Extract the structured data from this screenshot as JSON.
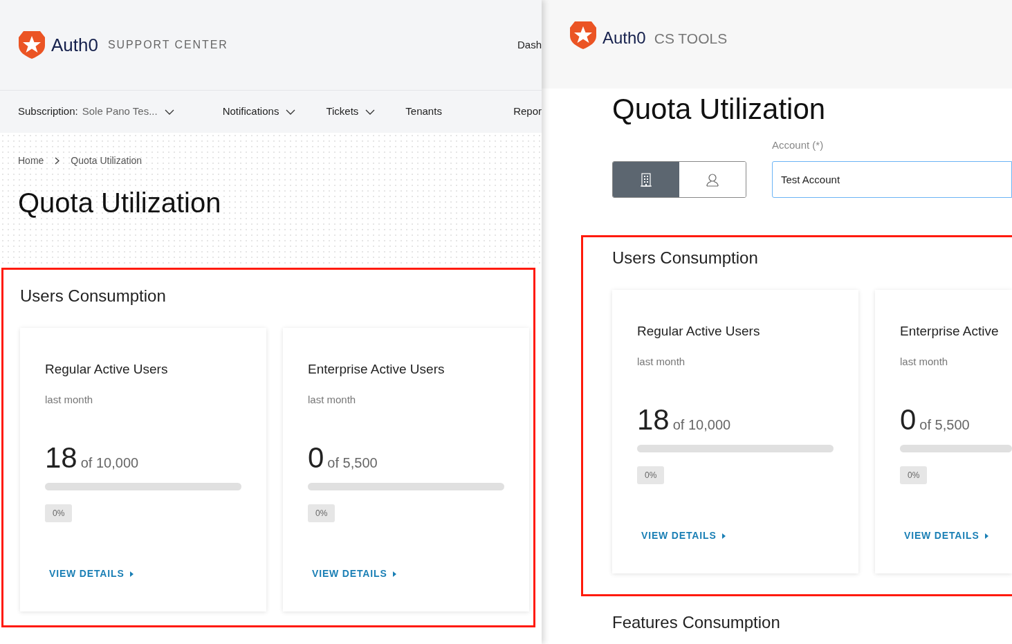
{
  "left": {
    "brand": "Auth0",
    "product": "SUPPORT CENTER",
    "top_link": "Dash",
    "nav": [
      {
        "label": "Subscription:",
        "value": "Sole Pano Tes...",
        "dropdown": true
      },
      {
        "label": "Notifications",
        "dropdown": true
      },
      {
        "label": "Tickets",
        "dropdown": true
      },
      {
        "label": "Tenants",
        "dropdown": false
      },
      {
        "label": "Repor",
        "dropdown": false
      }
    ],
    "breadcrumb": [
      "Home",
      "Quota Utilization"
    ],
    "title": "Quota Utilization",
    "section": {
      "title": "Users Consumption",
      "highlighted": true,
      "cards": [
        {
          "title": "Regular Active Users",
          "subtitle": "last month",
          "value": "18",
          "total": "of 10,000",
          "level": 0,
          "percent": "0%",
          "link": "VIEW DETAILS"
        },
        {
          "title": "Enterprise Active Users",
          "subtitle": "last month",
          "value": "0",
          "total": "of 5,500",
          "level": 0,
          "percent": "0%",
          "link": "VIEW DETAILS"
        }
      ]
    }
  },
  "right": {
    "brand": "Auth0",
    "product": "CS TOOLS",
    "title": "Quota Utilization",
    "toggle": [
      {
        "kind": "building",
        "selected": true
      },
      {
        "kind": "person",
        "selected": false
      }
    ],
    "account": {
      "label": "Account (*)",
      "value": "Test Account"
    },
    "section": {
      "title": "Users Consumption",
      "highlighted": true,
      "cards": [
        {
          "title": "Regular Active Users",
          "subtitle": "last month",
          "value": "18",
          "total": "of 10,000",
          "level": 0,
          "percent": "0%",
          "link": "VIEW DETAILS"
        },
        {
          "title": "Enterprise Active",
          "subtitle": "last month",
          "value": "0",
          "total": "of 5,500",
          "level": 0,
          "percent": "0%",
          "link": "VIEW DETAILS"
        }
      ]
    },
    "next_section": "Features Consumption"
  }
}
